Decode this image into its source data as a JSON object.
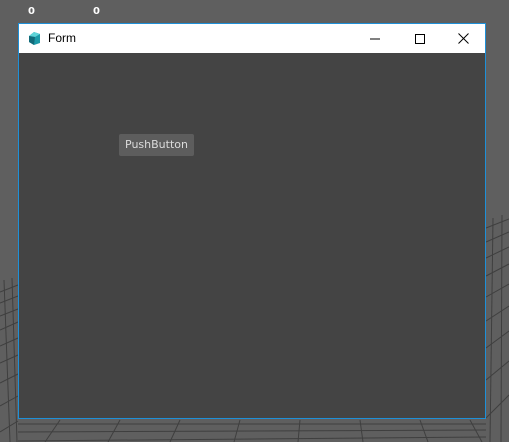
{
  "viewport": {
    "hud_values": [
      "0",
      "0"
    ]
  },
  "window": {
    "title": "Form",
    "icon": "app-icon",
    "controls": {
      "minimize": "minimize-icon",
      "maximize": "maximize-icon",
      "close": "close-icon"
    }
  },
  "form": {
    "push_button_label": "PushButton"
  },
  "colors": {
    "window_border": "#1e90d8",
    "client_background": "#444444",
    "viewport_background": "#5f5f5f",
    "button_background": "#5d5d5d"
  }
}
